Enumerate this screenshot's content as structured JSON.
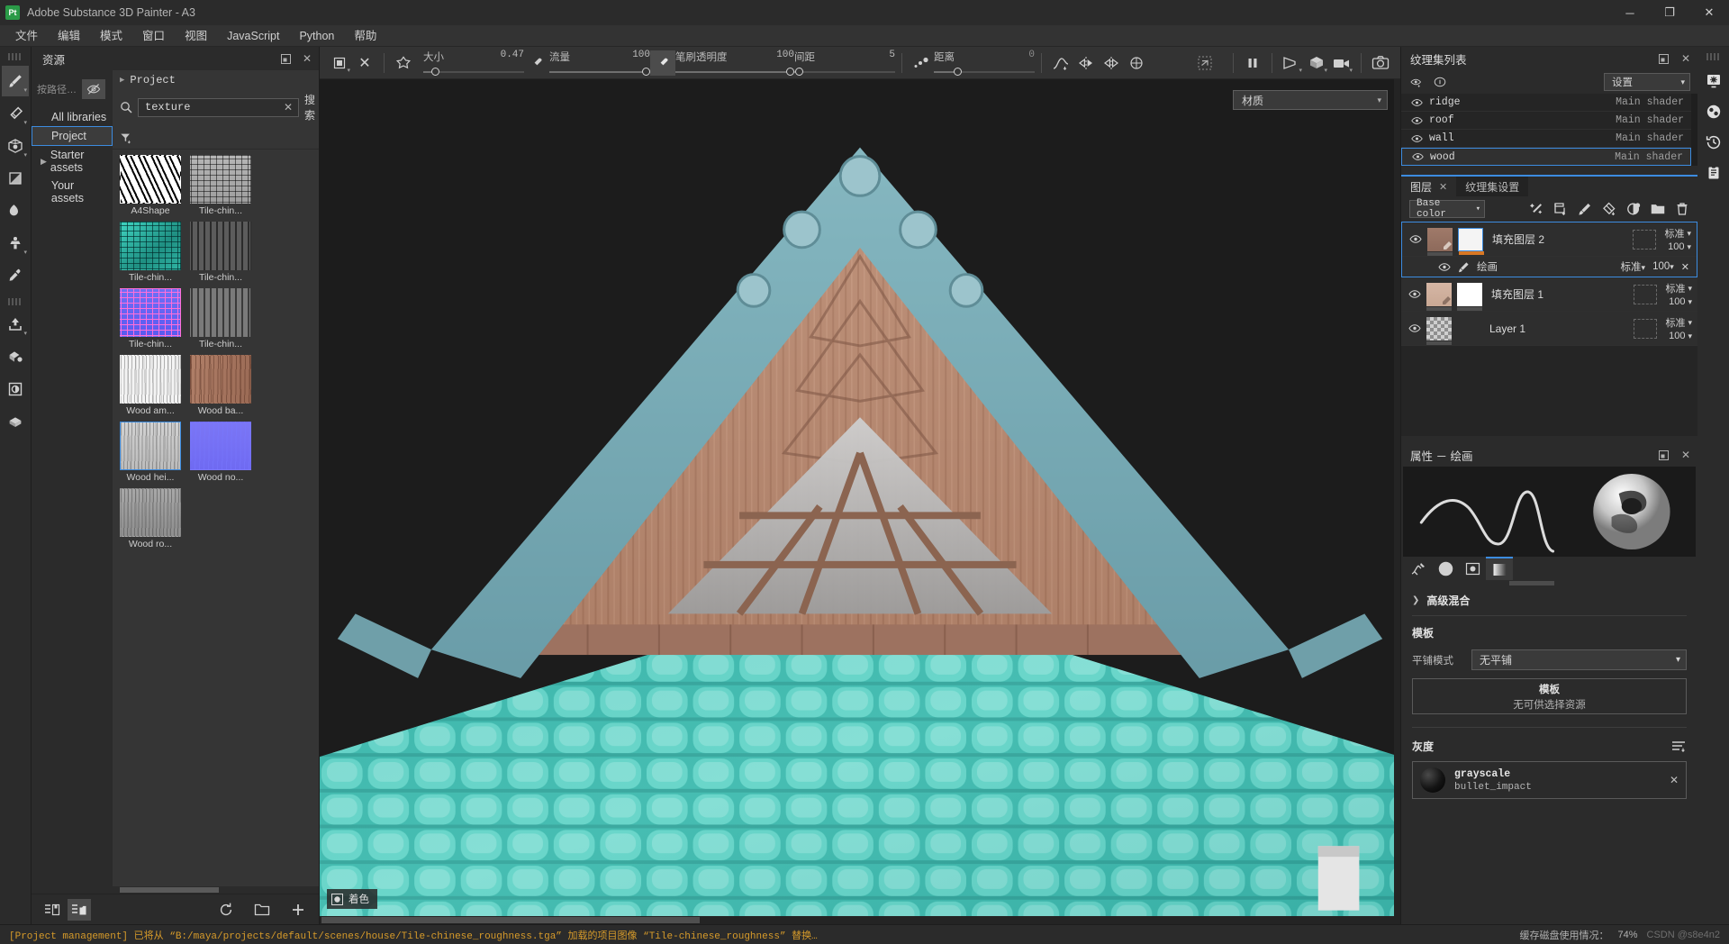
{
  "window": {
    "logo": "Pt",
    "title": "Adobe Substance 3D Painter - A3",
    "minimize": "─",
    "maximize": "❐",
    "close": "✕"
  },
  "menubar": {
    "items": [
      {
        "label": "文件"
      },
      {
        "label": "编辑"
      },
      {
        "label": "模式"
      },
      {
        "label": "窗口"
      },
      {
        "label": "视图"
      },
      {
        "label": "JavaScript"
      },
      {
        "label": "Python"
      },
      {
        "label": "帮助"
      }
    ]
  },
  "left_tools": {
    "items": [
      {
        "name": "paint-brush-tool",
        "active": true,
        "caret": true
      },
      {
        "name": "eraser-tool",
        "active": false,
        "caret": true
      },
      {
        "name": "projection-tool",
        "active": false,
        "caret": true
      },
      {
        "name": "polygon-fill-tool",
        "active": false,
        "caret": false
      },
      {
        "name": "smudge-tool",
        "active": false,
        "caret": false
      },
      {
        "name": "clone-stamp-tool",
        "active": false,
        "caret": true
      },
      {
        "name": "material-picker-tool",
        "active": false,
        "caret": false
      },
      {
        "name": "bake-tool",
        "active": false,
        "caret": true
      },
      {
        "name": "geometry-mask-tool",
        "active": false,
        "caret": false
      },
      {
        "name": "viewer-settings-tool",
        "active": false,
        "caret": false
      },
      {
        "name": "uv-tile-tool",
        "active": false,
        "caret": false
      }
    ]
  },
  "assets": {
    "panel_title": "资源",
    "search_path_label": "按路径…",
    "libraries": [
      {
        "label": "All libraries",
        "selected": false,
        "has_arrow": false
      },
      {
        "label": "Project",
        "selected": true,
        "has_arrow": false
      },
      {
        "label": "Starter assets",
        "selected": false,
        "has_arrow": true
      },
      {
        "label": "Your assets",
        "selected": false,
        "has_arrow": false
      }
    ],
    "breadcrumb": "Project",
    "search": {
      "value": "texture",
      "button_label": "搜索"
    },
    "thumbnails": [
      {
        "label": "A4Shape",
        "selected": false,
        "kind": "noise-bw"
      },
      {
        "label": "Tile-chin...",
        "selected": false,
        "kind": "tile-grey"
      },
      {
        "label": "Tile-chin...",
        "selected": false,
        "kind": "tile-teal"
      },
      {
        "label": "Tile-chin...",
        "selected": false,
        "kind": "tile-dark"
      },
      {
        "label": "Tile-chin...",
        "selected": false,
        "kind": "tile-normal"
      },
      {
        "label": "Tile-chin...",
        "selected": false,
        "kind": "tile-grey2"
      },
      {
        "label": "Wood am...",
        "selected": false,
        "kind": "wood-white"
      },
      {
        "label": "Wood ba...",
        "selected": false,
        "kind": "wood-brown"
      },
      {
        "label": "Wood hei...",
        "selected": true,
        "kind": "wood-grey"
      },
      {
        "label": "Wood no...",
        "selected": false,
        "kind": "wood-normal"
      },
      {
        "label": "Wood ro...",
        "selected": false,
        "kind": "wood-rough"
      }
    ]
  },
  "brushbar": {
    "sliders": [
      {
        "name": "大小",
        "value": "0.47",
        "fill_pct": 12
      },
      {
        "name": "流量",
        "value": "100",
        "fill_pct": 100
      },
      {
        "name": "笔刷透明度",
        "value": "100",
        "fill_pct": 100
      },
      {
        "name": "间距",
        "value": "5",
        "fill_pct": 6
      },
      {
        "name": "距离",
        "value": "0",
        "fill_pct": 25
      }
    ],
    "right_icons": [
      {
        "name": "symmetry-off-icon"
      },
      {
        "name": "pause-engine-icon"
      },
      {
        "name": "camera-perspective-icon"
      },
      {
        "name": "display-settings-icon"
      },
      {
        "name": "video-record-icon"
      },
      {
        "name": "screenshot-icon"
      }
    ]
  },
  "viewport": {
    "channel_dropdown": "材质",
    "shading_badge": "着色"
  },
  "texture_set_list": {
    "title": "纹理集列表",
    "settings_label": "设置",
    "rows": [
      {
        "name": "ridge",
        "shader": "Main shader",
        "selected": false
      },
      {
        "name": "roof",
        "shader": "Main shader",
        "selected": false
      },
      {
        "name": "wall",
        "shader": "Main shader",
        "selected": false
      },
      {
        "name": "wood",
        "shader": "Main shader",
        "selected": true
      }
    ]
  },
  "layers_panel": {
    "tabs": [
      {
        "label": "图层",
        "active": true,
        "closable": true
      },
      {
        "label": "纹理集设置",
        "active": false,
        "closable": false
      }
    ],
    "channel": "Base color",
    "toolbar_icons": [
      {
        "name": "add-effect-icon"
      },
      {
        "name": "add-fill-layer-icon"
      },
      {
        "name": "add-paint-layer-icon"
      },
      {
        "name": "add-smart-material-icon"
      },
      {
        "name": "add-mask-icon"
      },
      {
        "name": "add-folder-icon"
      },
      {
        "name": "delete-layer-icon"
      }
    ],
    "layers": [
      {
        "name": "填充图层 2",
        "blend": "标准",
        "opacity": "100",
        "selected": true,
        "visible": true,
        "thumb": "fill-brown",
        "has_mask_bar": true,
        "sub": {
          "name": "绘画",
          "blend": "标准",
          "opacity": "100",
          "visible": true
        }
      },
      {
        "name": "填充图层 1",
        "blend": "标准",
        "opacity": "100",
        "selected": false,
        "visible": true,
        "thumb": "fill-tan",
        "has_mask_bar": true,
        "sub": null
      },
      {
        "name": "Layer 1",
        "blend": "标准",
        "opacity": "100",
        "selected": false,
        "visible": true,
        "thumb": "checker",
        "has_mask_bar": true,
        "sub": null
      }
    ]
  },
  "properties_panel": {
    "title": "属性 － 绘画",
    "tabs": [
      {
        "name": "brush-stroke-tab",
        "active": false
      },
      {
        "name": "alpha-tab",
        "active": false
      },
      {
        "name": "stencil-tab",
        "active": false
      },
      {
        "name": "gradient-tab",
        "active": true
      }
    ],
    "advanced_blending": "高级混合",
    "stencil_section": "模板",
    "tiling_label": "平铺模式",
    "tiling_value": "无平铺",
    "stencil_slot_title": "模板",
    "stencil_slot_sub": "无可供选择资源",
    "grayscale_section": "灰度",
    "grayscale_resource_name": "grayscale",
    "grayscale_resource_sub": "bullet_impact"
  },
  "right_strip": {
    "items": [
      {
        "name": "display-settings-icon"
      },
      {
        "name": "shader-settings-icon"
      },
      {
        "name": "history-icon"
      },
      {
        "name": "log-icon"
      }
    ]
  },
  "assets_footer": {
    "left_icons": [
      {
        "name": "list-view-icon",
        "active": false
      },
      {
        "name": "grid-view-icon",
        "active": true
      }
    ],
    "right_icons": [
      {
        "name": "refresh-icon"
      },
      {
        "name": "new-folder-icon"
      },
      {
        "name": "add-resource-icon"
      }
    ]
  },
  "statusbar": {
    "message": "[Project management] 已将从 “B:/maya/projects/default/scenes/house/Tile-chinese_roughness.tga” 加载的项目图像 “Tile-chinese_roughness” 替换…",
    "cache_label": "缓存磁盘使用情况：",
    "cache_value": "74%",
    "watermark": "CSDN @s8e4n2"
  },
  "colors": {
    "accent": "#3c8ce0",
    "status_text": "#d79b2a",
    "panel_bg": "#2b2b2b",
    "list_bg": "#252525",
    "orange_bar": "#d87724"
  }
}
